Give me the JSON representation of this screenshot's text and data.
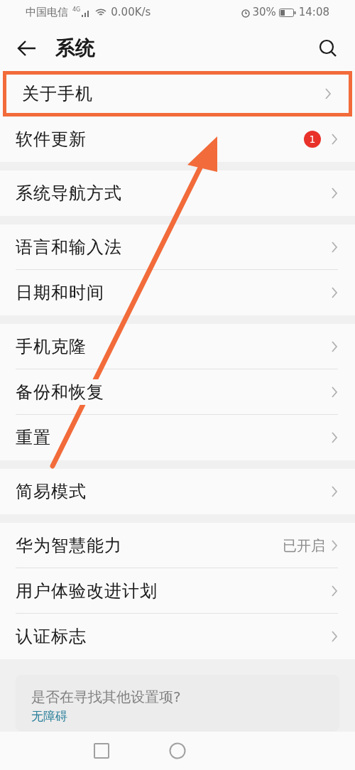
{
  "status_bar": {
    "carrier": "中国电信",
    "network": "4G",
    "speed": "0.00K/s",
    "battery": "30%",
    "time": "14:08"
  },
  "header": {
    "title": "系统"
  },
  "groups": [
    {
      "items": [
        {
          "label": "关于手机",
          "highlighted": true
        },
        {
          "label": "软件更新",
          "badge": "1",
          "highlighted": false
        }
      ]
    },
    {
      "items": [
        {
          "label": "系统导航方式",
          "highlighted": false
        }
      ]
    },
    {
      "items": [
        {
          "label": "语言和输入法",
          "highlighted": false
        },
        {
          "label": "日期和时间",
          "highlighted": false
        }
      ]
    },
    {
      "items": [
        {
          "label": "手机克隆",
          "highlighted": false
        },
        {
          "label": "备份和恢复",
          "highlighted": false
        },
        {
          "label": "重置",
          "highlighted": false
        }
      ]
    },
    {
      "items": [
        {
          "label": "简易模式",
          "highlighted": false
        }
      ]
    },
    {
      "items": [
        {
          "label": "华为智慧能力",
          "value": "已开启",
          "highlighted": false
        },
        {
          "label": "用户体验改进计划",
          "highlighted": false
        },
        {
          "label": "认证标志",
          "highlighted": false
        }
      ]
    }
  ],
  "suggestion_card": {
    "title": "是否在寻找其他设置项?",
    "links": [
      "无障碍"
    ]
  }
}
